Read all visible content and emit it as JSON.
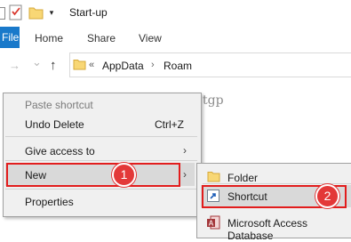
{
  "window": {
    "title": "Start-up"
  },
  "ribbon": {
    "tabs": [
      "File",
      "Home",
      "Share",
      "View"
    ]
  },
  "address": {
    "overflow_chevron": "«",
    "segments": [
      "AppData",
      "Roam"
    ],
    "separator": "›"
  },
  "nav_glyphs": {
    "forward": "→",
    "dropdown": "⌄",
    "up": "↑",
    "qa_dropdown": "▾"
  },
  "watermark": "@tgp",
  "context_menu": {
    "items": [
      {
        "label": "Paste shortcut",
        "disabled": true
      },
      {
        "label": "Undo Delete",
        "shortcut": "Ctrl+Z"
      },
      {
        "label": "Give access to",
        "submenu_arrow": "›"
      },
      {
        "label": "New",
        "submenu_arrow": "›",
        "highlighted": true
      },
      {
        "label": "Properties"
      }
    ]
  },
  "submenu": {
    "items": [
      {
        "label": "Folder",
        "icon": "folder-icon"
      },
      {
        "label": "Shortcut",
        "icon": "shortcut-icon",
        "highlighted": true
      },
      {
        "label": "Microsoft Access Database",
        "icon": "access-icon"
      }
    ]
  },
  "annotations": {
    "step1": "1",
    "step2": "2"
  },
  "colors": {
    "accent": "#1979ca",
    "highlight": "#d9d9d9",
    "annotation_red": "#e21d1d",
    "folder_yellow": "#f8d775"
  }
}
